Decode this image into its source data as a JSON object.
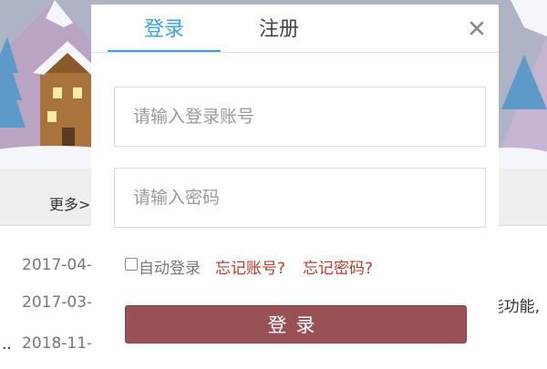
{
  "background": {
    "more_link": "更多>",
    "news_dates": [
      "2017-04-",
      "2017-03-",
      "2018-11-"
    ],
    "news_snippet": "能功能,",
    "ellipsis": ".."
  },
  "modal": {
    "tabs": [
      {
        "label": "登录",
        "active": true
      },
      {
        "label": "注册",
        "active": false
      }
    ],
    "close_symbol": "×",
    "account_placeholder": "请输入登录账号",
    "password_placeholder": "请输入密码",
    "auto_login_label": "自动登录",
    "auto_login_checked": false,
    "forgot_account": "忘记账号?",
    "forgot_password": "忘记密码?",
    "submit_label": "登录"
  },
  "colors": {
    "accent": "#36a3ef",
    "link": "#c0392b",
    "button": "#9a5155"
  }
}
